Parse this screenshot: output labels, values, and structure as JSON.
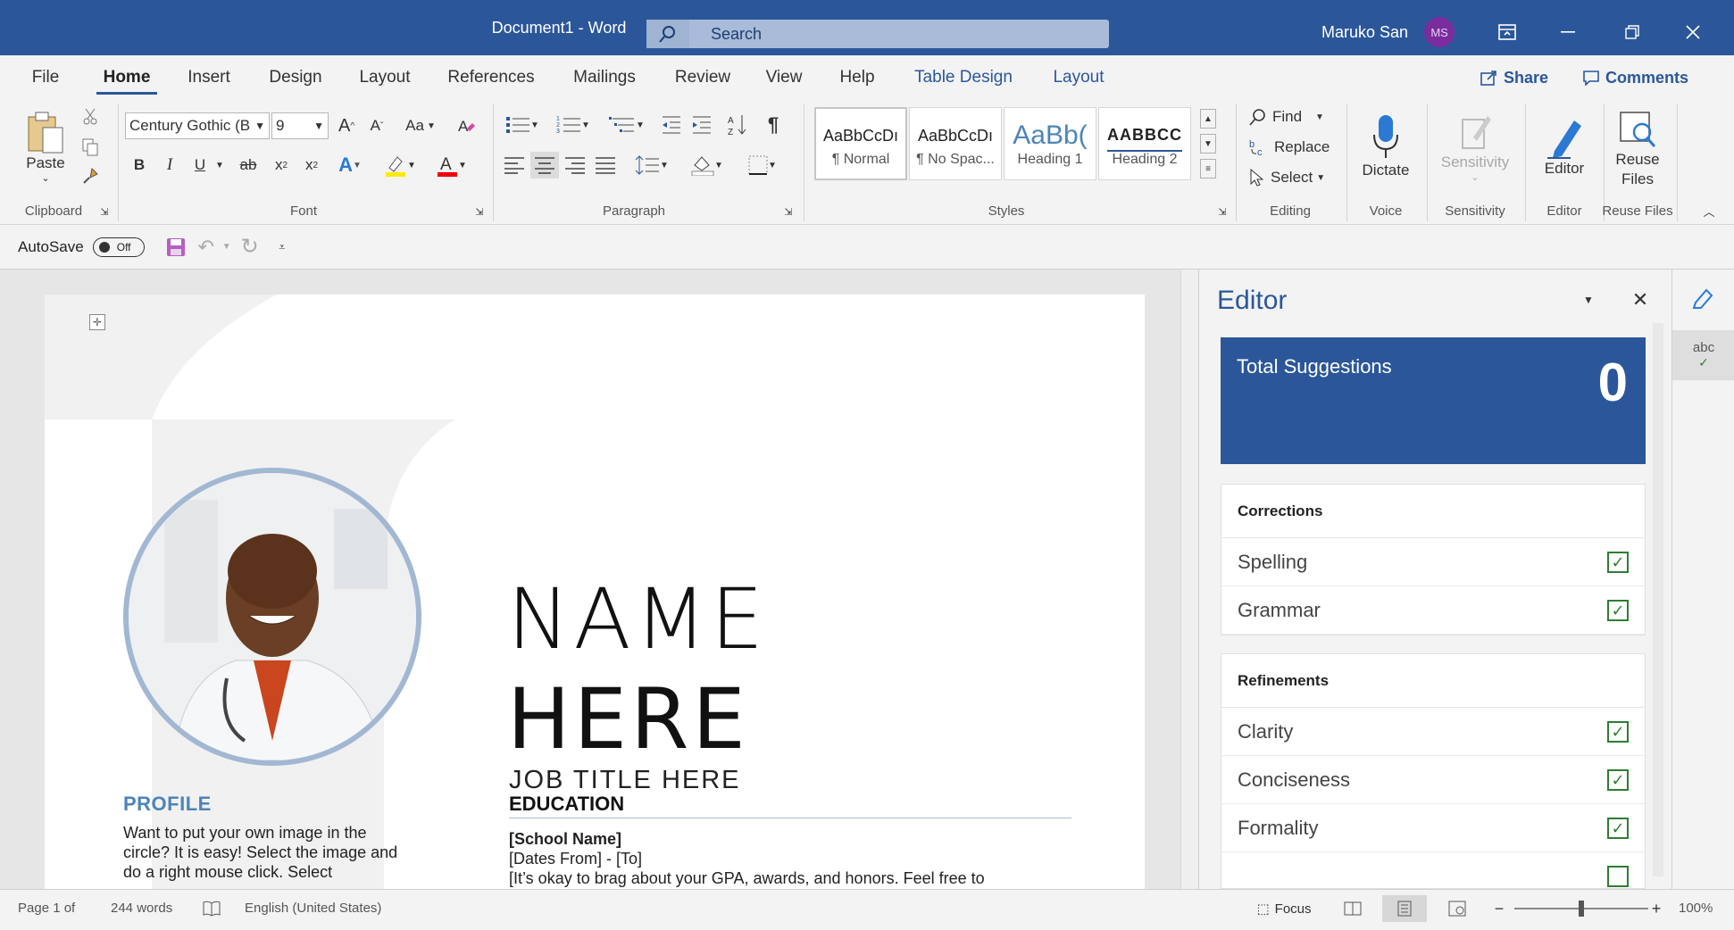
{
  "window": {
    "title": "Document1  -  Word",
    "search_placeholder": "Search",
    "user_name": "Maruko San",
    "user_initials": "MS"
  },
  "tabs": [
    "File",
    "Home",
    "Insert",
    "Design",
    "Layout",
    "References",
    "Mailings",
    "Review",
    "View",
    "Help",
    "Table Design",
    "Layout"
  ],
  "tabs_active": "Home",
  "actions": {
    "share": "Share",
    "comments": "Comments"
  },
  "clipboard": {
    "paste": "Paste",
    "label": "Clipboard"
  },
  "font": {
    "family": "Century Gothic (B",
    "size": "9",
    "label": "Font",
    "case_label": "Aa"
  },
  "paragraph": {
    "label": "Paragraph"
  },
  "styles": {
    "label": "Styles",
    "items": [
      {
        "preview": "AaBbCcDı",
        "name": "¶ Normal"
      },
      {
        "preview": "AaBbCcDı",
        "name": "¶ No Spac..."
      },
      {
        "preview": "AaBb(",
        "name": "Heading 1"
      },
      {
        "preview": "AABBCC",
        "name": "Heading 2"
      }
    ]
  },
  "editing": {
    "find": "Find",
    "replace": "Replace",
    "select": "Select",
    "label": "Editing"
  },
  "voice": {
    "dictate": "Dictate",
    "label": "Voice"
  },
  "sensitivity": {
    "button": "Sensitivity",
    "label": "Sensitivity"
  },
  "editor_group": {
    "button": "Editor",
    "label": "Editor"
  },
  "reuse": {
    "button_line1": "Reuse",
    "button_line2": "Files",
    "label": "Reuse Files"
  },
  "qat": {
    "autosave": "AutoSave",
    "toggle": "Off"
  },
  "document": {
    "profile_heading": "PROFILE",
    "profile_text": "Want to put your own image in the circle?  It is easy!  Select the image and do a right mouse click.  Select",
    "name_line1": "NAME",
    "name_line2": "HERE",
    "job_title": "JOB TITLE HERE",
    "education_heading": "EDUCATION",
    "school": "[School Name]",
    "dates": "[Dates From] - [To]",
    "education_desc": "[It’s okay to brag about your GPA, awards, and honors. Feel free to"
  },
  "editor_pane": {
    "title": "Editor",
    "total_label": "Total Suggestions",
    "total_count": "0",
    "corrections_heading": "Corrections",
    "corrections": [
      "Spelling",
      "Grammar"
    ],
    "refinements_heading": "Refinements",
    "refinements": [
      "Clarity",
      "Conciseness",
      "Formality"
    ],
    "rail_label": "abc"
  },
  "status": {
    "page": "Page 1 of",
    "words": "244 words",
    "language": "English (United States)",
    "focus": "Focus",
    "zoom": "100%"
  }
}
